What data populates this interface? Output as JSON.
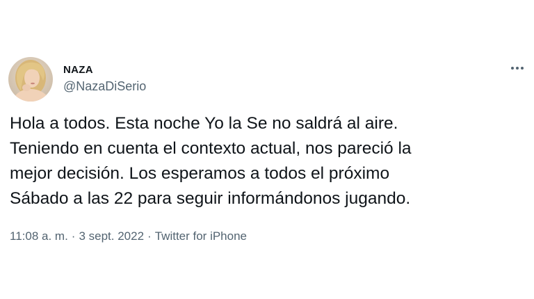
{
  "author": {
    "display_name": "NAZA",
    "handle": "@NazaDiSerio"
  },
  "tweet": {
    "text_lines": [
      "Hola a todos. Esta noche Yo la Se no saldrá al aire.",
      "Teniendo en cuenta el contexto actual, nos pareció la",
      "mejor decisión. Los esperamos a todos el próximo",
      "Sábado a las 22 para seguir informándonos jugando."
    ],
    "time": "11:08 a. m.",
    "separator": "·",
    "date": "3 sept. 2022",
    "source": "Twitter for iPhone"
  },
  "icons": {
    "more": "more-options-icon",
    "avatar": "profile-photo"
  },
  "colors": {
    "text_primary": "#0f1419",
    "text_secondary": "#536471",
    "background": "#ffffff"
  }
}
